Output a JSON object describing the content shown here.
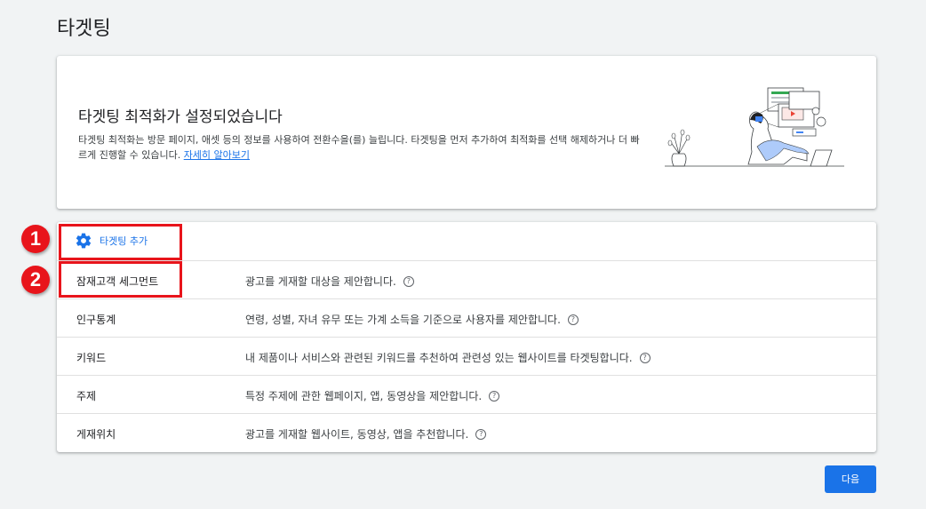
{
  "page": {
    "title": "타겟팅"
  },
  "info": {
    "title": "타겟팅 최적화가 설정되었습니다",
    "description": "타겟팅 최적화는 방문 페이지, 애셋 등의 정보를 사용하여 전환수을(를) 늘립니다. 타겟팅을 먼저 추가하여 최적화를 선택 해제하거나 더 빠르게 진행할 수 있습니다.",
    "learn_more": "자세히 알아보기"
  },
  "add_targeting": {
    "label": "타겟팅 추가",
    "icon": "gear-icon"
  },
  "rows": [
    {
      "name": "잠재고객 세그먼트",
      "desc": "광고를 게재할 대상을 제안합니다."
    },
    {
      "name": "인구통계",
      "desc": "연령, 성별, 자녀 유무 또는 가계 소득을 기준으로 사용자를 제안합니다."
    },
    {
      "name": "키워드",
      "desc": "내 제품이나 서비스와 관련된 키워드를 추천하여 관련성 있는 웹사이트를 타겟팅합니다."
    },
    {
      "name": "주제",
      "desc": "특정 주제에 관한 웹페이지, 앱, 동영상을 제안합니다."
    },
    {
      "name": "게재위치",
      "desc": "광고를 게재할 웹사이트, 동영상, 앱을 추천합니다."
    }
  ],
  "help_glyph": "?",
  "annotations": {
    "badge1": "1",
    "badge2": "2"
  },
  "footer": {
    "next_label": "다음"
  },
  "colors": {
    "accent": "#1a73e8",
    "highlight": "#e8141b",
    "background": "#f1f3f4"
  }
}
